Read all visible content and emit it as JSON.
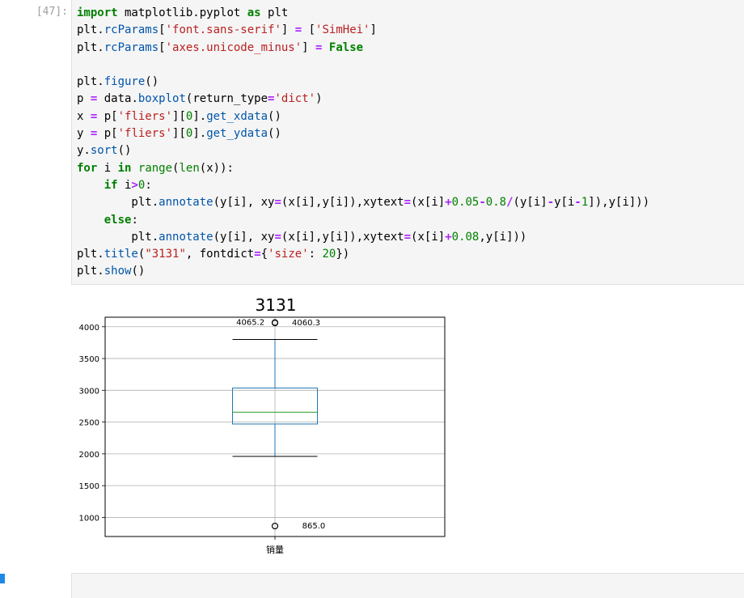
{
  "cell": {
    "prompt": "[47]:",
    "code": {
      "l1": {
        "a": "import",
        "b": " matplotlib.pyplot ",
        "c": "as",
        "d": " plt"
      },
      "l2": {
        "a": "plt.",
        "b": "rcParams",
        "c": "[",
        "d": "'font.sans-serif'",
        "e": "] ",
        "f": "=",
        "g": " [",
        "h": "'SimHei'",
        "i": "]"
      },
      "l3": {
        "a": "plt.",
        "b": "rcParams",
        "c": "[",
        "d": "'axes.unicode_minus'",
        "e": "] ",
        "f": "=",
        "g": " ",
        "h": "False"
      },
      "l5": {
        "a": "plt.",
        "b": "figure",
        "c": "()"
      },
      "l6": {
        "a": "p ",
        "b": "=",
        "c": " data.",
        "d": "boxplot",
        "e": "(return_type",
        "f": "=",
        "g": "'dict'",
        "h": ")"
      },
      "l7": {
        "a": "x ",
        "b": "=",
        "c": " p[",
        "d": "'fliers'",
        "e": "][",
        "f": "0",
        "g": "].",
        "h": "get_xdata",
        "i": "()"
      },
      "l8": {
        "a": "y ",
        "b": "=",
        "c": " p[",
        "d": "'fliers'",
        "e": "][",
        "f": "0",
        "g": "].",
        "h": "get_ydata",
        "i": "()"
      },
      "l9": {
        "a": "y.",
        "b": "sort",
        "c": "()"
      },
      "l10": {
        "a": "for",
        "b": " i ",
        "c": "in",
        "d": " ",
        "e": "range",
        "f": "(",
        "g": "len",
        "h": "(x)):"
      },
      "l11": {
        "a": "    ",
        "b": "if",
        "c": " i",
        "d": ">",
        "e": "0",
        "f": ":"
      },
      "l12": {
        "a": "        plt.",
        "b": "annotate",
        "c": "(y[i], xy",
        "d": "=",
        "e": "(x[i],y[i]),xytext",
        "f": "=",
        "g": "(x[i]",
        "h": "+",
        "i": "0.05",
        "j": "-",
        "k": "0.8",
        "l": "/",
        "m": "(y[i]",
        "n": "-",
        "o": "y[i",
        "p": "-",
        "q": "1",
        "r": "]),y[i]))"
      },
      "l13": {
        "a": "    ",
        "b": "else",
        "c": ":"
      },
      "l14": {
        "a": "        plt.",
        "b": "annotate",
        "c": "(y[i], xy",
        "d": "=",
        "e": "(x[i],y[i]),xytext",
        "f": "=",
        "g": "(x[i]",
        "h": "+",
        "i": "0.08",
        "j": ",y[i]))"
      },
      "l15": {
        "a": "plt.",
        "b": "title",
        "c": "(",
        "d": "\"3131\"",
        "e": ", fontdict",
        "f": "=",
        "g": "{",
        "h": "'size'",
        "i": ": ",
        "j": "20",
        "k": "})"
      },
      "l16": {
        "a": "plt.",
        "b": "show",
        "c": "()"
      }
    }
  },
  "chart_data": {
    "type": "boxplot",
    "title": "3131",
    "xlabel": "",
    "ylabel": "",
    "categories": [
      "销量"
    ],
    "ylim": [
      700,
      4150
    ],
    "yticks": [
      1000,
      1500,
      2000,
      2500,
      3000,
      3500,
      4000
    ],
    "ytick_labels": [
      "1000",
      "1500",
      "2000",
      "2500",
      "3000",
      "3500",
      "4000"
    ],
    "grid": true,
    "box": {
      "whisker_low": 1960,
      "q1": 2470,
      "median": 2655,
      "q3": 3035,
      "whisker_high": 3800
    },
    "fliers": [
      865.0,
      4060.3,
      4065.2
    ],
    "annotations": [
      {
        "text": "865.0",
        "x": 1.08,
        "y": 865.0
      },
      {
        "text": "4060.3",
        "x": 1.05,
        "y": 4060.3
      },
      {
        "text": "4065.2",
        "x": 0.886,
        "y": 4065.2
      }
    ],
    "colors": {
      "box": "#1f77b4",
      "median": "#2ca02c",
      "whisker": "#1f77b4",
      "cap": "#000000",
      "grid": "#b0b0b0"
    }
  }
}
